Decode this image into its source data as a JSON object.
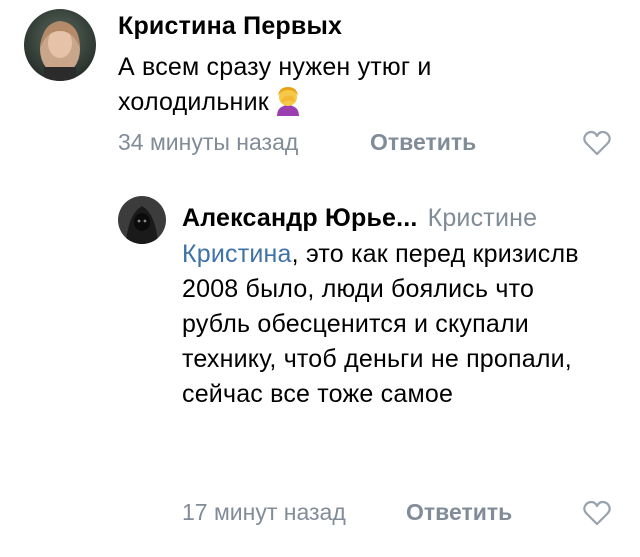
{
  "comments": [
    {
      "author": "Кристина Первых",
      "text": "А всем сразу нужен утюг и холодильник",
      "emoji": "facepalm-emoji",
      "time": "34 минуты назад",
      "reply_label": "Ответить",
      "like_icon": "heart-outline-icon"
    },
    {
      "author": "Александр Юрье...",
      "reply_to": "Кристине",
      "mention": "Кристина",
      "text_line1": ", это как перед",
      "text_rest": "кризислв 2008 было, люди боялись что рубль обесценится и скупали технику, чтоб деньги не пропали, сейчас все тоже самое",
      "time": "17 минут назад",
      "reply_label": "Ответить",
      "like_icon": "heart-outline-icon"
    }
  ],
  "colors": {
    "meta_gray": "#818c99",
    "mention_blue": "#3f72a8",
    "text": "#000000"
  }
}
